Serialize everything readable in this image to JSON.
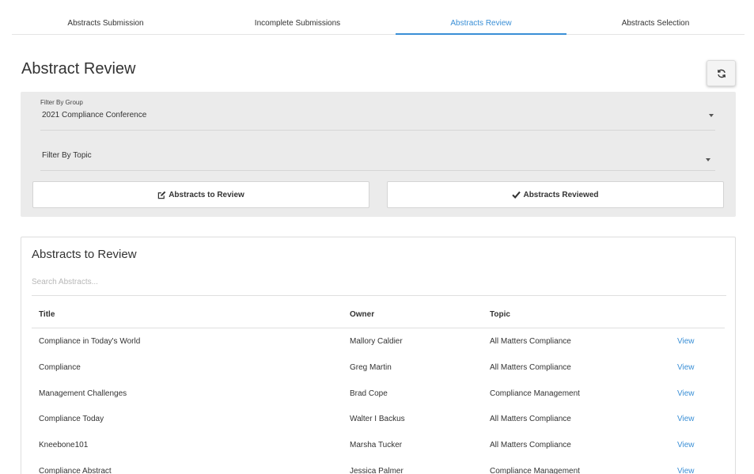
{
  "tabs": [
    {
      "label": "Abstracts Submission",
      "active": false
    },
    {
      "label": "Incomplete Submissions",
      "active": false
    },
    {
      "label": "Abstracts Review",
      "active": true
    },
    {
      "label": "Abstracts Selection",
      "active": false
    }
  ],
  "page": {
    "title": "Abstract Review"
  },
  "filters": {
    "group_label": "Filter By Group",
    "group_value": "2021 Compliance Conference",
    "topic_placeholder": "Filter By Topic"
  },
  "modes": {
    "to_review_label": "Abstracts to Review",
    "reviewed_label": "Abstracts Reviewed"
  },
  "list": {
    "title": "Abstracts to Review",
    "search_placeholder": "Search Abstracts...",
    "columns": [
      "Title",
      "Owner",
      "Topic"
    ],
    "view_label": "View",
    "rows": [
      {
        "title": "Compliance in Today's World",
        "owner": "Mallory Caldier",
        "topic": "All Matters Compliance"
      },
      {
        "title": "Compliance",
        "owner": "Greg Martin",
        "topic": "All Matters Compliance"
      },
      {
        "title": "Management Challenges",
        "owner": "Brad Cope",
        "topic": "Compliance Management"
      },
      {
        "title": "Compliance Today",
        "owner": "Walter I Backus",
        "topic": "All Matters Compliance"
      },
      {
        "title": "Kneebone101",
        "owner": "Marsha Tucker",
        "topic": "All Matters Compliance"
      },
      {
        "title": "Compliance Abstract",
        "owner": "Jessica Palmer",
        "topic": "Compliance Management"
      }
    ]
  },
  "colors": {
    "accent": "#3a8fd6",
    "panel_bg": "#ebebeb"
  },
  "icons": {
    "refresh": "refresh-icon",
    "edit": "edit-icon",
    "check": "check-icon",
    "dropdown": "caret-down-icon"
  }
}
